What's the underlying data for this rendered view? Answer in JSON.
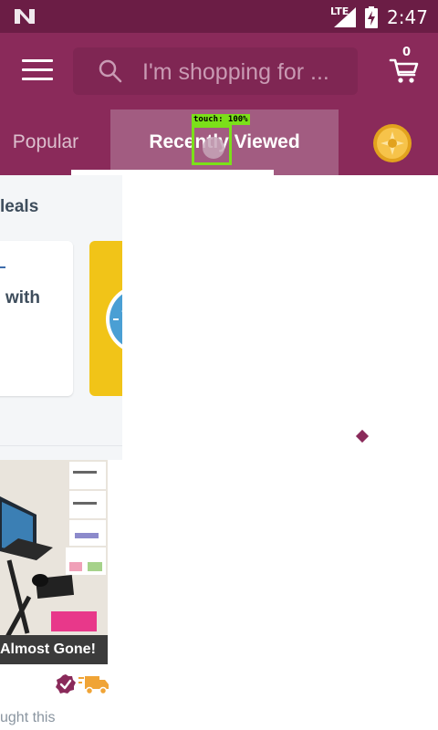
{
  "status_bar": {
    "network": "LTE",
    "time": "2:47"
  },
  "header": {
    "search": {
      "placeholder": "I'm shopping for ..."
    },
    "cart_count": "0"
  },
  "tabs": [
    {
      "label": "Popular",
      "selected": false
    },
    {
      "label": "Recently Viewed",
      "selected": true
    }
  ],
  "touch_overlay": {
    "label": "touch: 100%"
  },
  "content": {
    "deals_title": "leals",
    "deal_card_text": "with",
    "product": {
      "banner": "Almost Gone!",
      "caption": "ught this"
    }
  },
  "colors": {
    "brand": "#8a2a5a",
    "status_bar": "#6b1d45",
    "active_tab": "#a25c81",
    "promo_yellow": "#f1c418",
    "touch_indicator": "#7be019"
  },
  "icons": [
    "menu-icon",
    "search-icon",
    "cart-icon",
    "coin-icon",
    "verified-icon",
    "truck-icon"
  ]
}
